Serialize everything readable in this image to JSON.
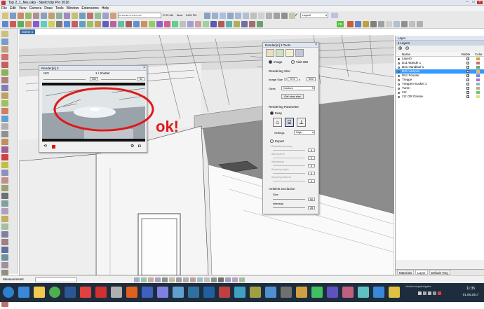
{
  "window": {
    "title": "Typ 2_1_Neu.skp - SketchUp Pro 2016"
  },
  "menu": [
    "File",
    "Edit",
    "View",
    "Camera",
    "Draw",
    "Tools",
    "Window",
    "Extensions",
    "Help"
  ],
  "scene_tab": "Scene 1",
  "toolbar": {
    "layer_select": "Layer0",
    "time_labels": [
      "J F M A M J J A S O N D",
      "07:21 AM",
      "Noon",
      "04:51 PM"
    ],
    "fb_label": "FB"
  },
  "preview": {
    "title": "Render[in] 3",
    "iso_label": "ISO",
    "iso_value": "250",
    "shutter_label": "1 / Shutter",
    "shutter_value": "50",
    "ok_text": "ok!"
  },
  "tools": {
    "title": "Render[in] 3 Tools",
    "mode_image": "Image",
    "mode_vr": "Visit 360",
    "rendering_size_label": "Rendering Size",
    "image_size_label": "Image Size",
    "image_w": "974",
    "image_h": "500",
    "size_sep": "x",
    "sizes_label": "Sizes",
    "sizes_value": "Custom",
    "get_view_size": "Get view size",
    "param_label": "Rendering Parameter",
    "easy_label": "Easy",
    "settings_label": "Settings",
    "settings_value": "High",
    "expert_label": "Expert",
    "expert_items": [
      "Radiosity Accuracy",
      "Atmosphere",
      "Antialiasing",
      "Sampling Lights",
      "Sampling Material"
    ],
    "expert_values": [
      "0",
      "0",
      "0",
      "0",
      "0"
    ],
    "ao_label": "Ambient Occlusion",
    "ao_size_label": "Size",
    "ao_size_value": "50",
    "ao_intensity_label": "Intensity",
    "ao_intensity_value": "35"
  },
  "layers": {
    "panel_title": "Layer",
    "tray_title": "Layers",
    "col_name": "Name",
    "col_visible": "Visible",
    "col_color": "Color",
    "items": [
      {
        "name": "Layer0",
        "color": "#c2ac3c",
        "active": true
      },
      {
        "name": "D11 Wände 1",
        "color": "#d86a6a"
      },
      {
        "name": "D21 Handlauf 1",
        "color": "#6aa86a"
      },
      {
        "name": "D31 Lampen",
        "color": "#e8b86a",
        "selected": true
      },
      {
        "name": "D51 Fenster",
        "color": "#6a8ad8"
      },
      {
        "name": "Treppe",
        "color": "#b36ad8"
      },
      {
        "name": "Treppen-Sockel 1",
        "color": "#8ab8c8"
      },
      {
        "name": "Turen",
        "color": "#c8a882"
      },
      {
        "name": "zzz",
        "color": "#7ac07a"
      },
      {
        "name": "zzz GR Glosse",
        "color": "#e0e080"
      }
    ]
  },
  "bottom_tabs": [
    "Materials",
    "Layer",
    "Default Tray"
  ],
  "status": {
    "measurements_label": "Measurements"
  },
  "clock": {
    "time": "11:35",
    "date": "01.06.2017",
    "tray_text": "Verbindungsfreigabe"
  }
}
